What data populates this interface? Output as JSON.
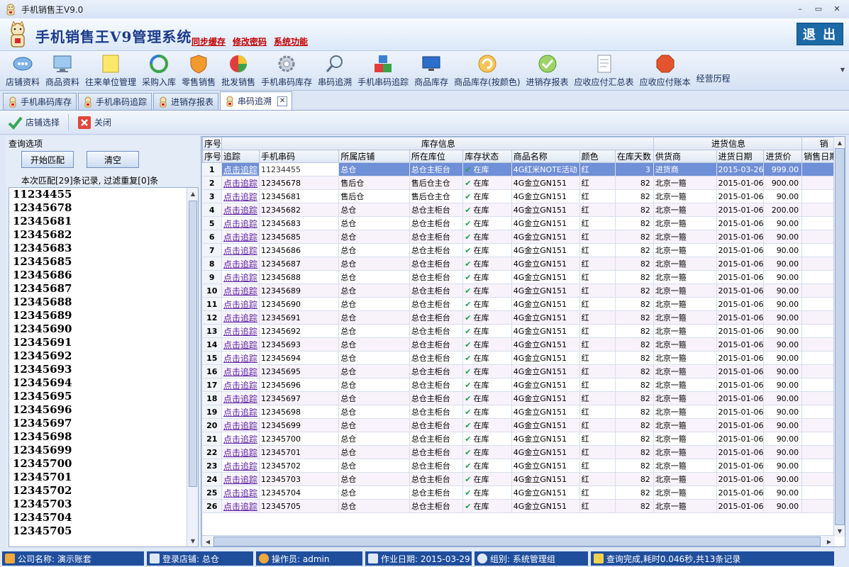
{
  "window": {
    "title": "手机销售王V9.0",
    "min": "–",
    "max": "▭",
    "close": "✕"
  },
  "banner": {
    "system_title": "手机销售王V9管理系统",
    "links": [
      "同步缓存",
      "修改密码",
      "系统功能"
    ],
    "exit_label": "退 出"
  },
  "toolbar": {
    "items": [
      {
        "label": "店铺资料",
        "icon": "store-icon"
      },
      {
        "label": "商品资料",
        "icon": "monitor-icon"
      },
      {
        "label": "往来单位管理",
        "icon": "folder-icon"
      },
      {
        "label": "采购入库",
        "icon": "refresh-icon"
      },
      {
        "label": "零售销售",
        "icon": "shield-icon"
      },
      {
        "label": "批发销售",
        "icon": "cube-icon"
      },
      {
        "label": "手机串码库存",
        "icon": "gear-icon"
      },
      {
        "label": "串码追溯",
        "icon": "magnifier-icon"
      },
      {
        "label": "手机串码追踪",
        "icon": "blocks-icon"
      },
      {
        "label": "商品库存",
        "icon": "monitor-icon"
      },
      {
        "label": "商品库存(按颜色)",
        "icon": "cycle-icon"
      },
      {
        "label": "进销存报表",
        "icon": "check-icon"
      },
      {
        "label": "应收应付汇总表",
        "icon": "document-icon"
      },
      {
        "label": "应收应付账本",
        "icon": "stop-icon"
      },
      {
        "label": "经营历程",
        "icon": ""
      }
    ]
  },
  "tabs": [
    {
      "label": "手机串码库存",
      "active": false
    },
    {
      "label": "手机串码追踪",
      "active": false
    },
    {
      "label": "进销存报表",
      "active": false
    },
    {
      "label": "串码追溯",
      "active": true
    }
  ],
  "subbar": {
    "store_select": "店铺选择",
    "close": "关闭"
  },
  "left": {
    "title": "查询选项",
    "match_button": "开始匹配",
    "clear_button": "清空",
    "match_info": "本次匹配[29]条记录, 过滤重复[0]条",
    "serials": [
      "11234455",
      "12345678",
      "12345681",
      "12345682",
      "12345683",
      "12345685",
      "12345686",
      "12345687",
      "12345688",
      "12345689",
      "12345690",
      "12345691",
      "12345692",
      "12345693",
      "12345694",
      "12345695",
      "12345696",
      "12345697",
      "12345698",
      "12345699",
      "12345700",
      "12345701",
      "12345702",
      "12345703",
      "12345704",
      "12345705"
    ]
  },
  "grid": {
    "group_headers": {
      "seq": "序号",
      "stock": "库存信息",
      "purchase": "进货信息",
      "sale": "销"
    },
    "columns": [
      "序号",
      "追踪",
      "手机串码",
      "所属店铺",
      "所在库位",
      "库存状态",
      "商品名称",
      "颜色",
      "在库天数",
      "供货商",
      "进货日期",
      "进货价",
      "销售日期"
    ],
    "rows": [
      [
        "1",
        "点击追踪",
        "11234455",
        "总仓",
        "总仓主柜台",
        "在库",
        "4G红米NOTE活动",
        "红",
        "3",
        "进货商",
        "2015-03-26",
        "999.00",
        ""
      ],
      [
        "2",
        "点击追踪",
        "12345678",
        "售后仓",
        "售后仓主仓",
        "在库",
        "4G金立GN151",
        "红",
        "82",
        "北京一箍",
        "2015-01-06",
        "900.00",
        ""
      ],
      [
        "3",
        "点击追踪",
        "12345681",
        "售后仓",
        "售后仓主仓",
        "在库",
        "4G金立GN151",
        "红",
        "82",
        "北京一箍",
        "2015-01-06",
        "90.00",
        ""
      ],
      [
        "4",
        "点击追踪",
        "12345682",
        "总仓",
        "总仓主柜台",
        "在库",
        "4G金立GN151",
        "红",
        "82",
        "北京一箍",
        "2015-01-06",
        "200.00",
        ""
      ],
      [
        "5",
        "点击追踪",
        "12345683",
        "总仓",
        "总仓主柜台",
        "在库",
        "4G金立GN151",
        "红",
        "82",
        "北京一箍",
        "2015-01-06",
        "90.00",
        ""
      ],
      [
        "6",
        "点击追踪",
        "12345685",
        "总仓",
        "总仓主柜台",
        "在库",
        "4G金立GN151",
        "红",
        "82",
        "北京一箍",
        "2015-01-06",
        "90.00",
        ""
      ],
      [
        "7",
        "点击追踪",
        "12345686",
        "总仓",
        "总仓主柜台",
        "在库",
        "4G金立GN151",
        "红",
        "82",
        "北京一箍",
        "2015-01-06",
        "90.00",
        ""
      ],
      [
        "8",
        "点击追踪",
        "12345687",
        "总仓",
        "总仓主柜台",
        "在库",
        "4G金立GN151",
        "红",
        "82",
        "北京一箍",
        "2015-01-06",
        "90.00",
        ""
      ],
      [
        "9",
        "点击追踪",
        "12345688",
        "总仓",
        "总仓主柜台",
        "在库",
        "4G金立GN151",
        "红",
        "82",
        "北京一箍",
        "2015-01-06",
        "90.00",
        ""
      ],
      [
        "10",
        "点击追踪",
        "12345689",
        "总仓",
        "总仓主柜台",
        "在库",
        "4G金立GN151",
        "红",
        "82",
        "北京一箍",
        "2015-01-06",
        "90.00",
        ""
      ],
      [
        "11",
        "点击追踪",
        "12345690",
        "总仓",
        "总仓主柜台",
        "在库",
        "4G金立GN151",
        "红",
        "82",
        "北京一箍",
        "2015-01-06",
        "90.00",
        ""
      ],
      [
        "12",
        "点击追踪",
        "12345691",
        "总仓",
        "总仓主柜台",
        "在库",
        "4G金立GN151",
        "红",
        "82",
        "北京一箍",
        "2015-01-06",
        "90.00",
        ""
      ],
      [
        "13",
        "点击追踪",
        "12345692",
        "总仓",
        "总仓主柜台",
        "在库",
        "4G金立GN151",
        "红",
        "82",
        "北京一箍",
        "2015-01-06",
        "90.00",
        ""
      ],
      [
        "14",
        "点击追踪",
        "12345693",
        "总仓",
        "总仓主柜台",
        "在库",
        "4G金立GN151",
        "红",
        "82",
        "北京一箍",
        "2015-01-06",
        "90.00",
        ""
      ],
      [
        "15",
        "点击追踪",
        "12345694",
        "总仓",
        "总仓主柜台",
        "在库",
        "4G金立GN151",
        "红",
        "82",
        "北京一箍",
        "2015-01-06",
        "90.00",
        ""
      ],
      [
        "16",
        "点击追踪",
        "12345695",
        "总仓",
        "总仓主柜台",
        "在库",
        "4G金立GN151",
        "红",
        "82",
        "北京一箍",
        "2015-01-06",
        "90.00",
        ""
      ],
      [
        "17",
        "点击追踪",
        "12345696",
        "总仓",
        "总仓主柜台",
        "在库",
        "4G金立GN151",
        "红",
        "82",
        "北京一箍",
        "2015-01-06",
        "90.00",
        ""
      ],
      [
        "18",
        "点击追踪",
        "12345697",
        "总仓",
        "总仓主柜台",
        "在库",
        "4G金立GN151",
        "红",
        "82",
        "北京一箍",
        "2015-01-06",
        "90.00",
        ""
      ],
      [
        "19",
        "点击追踪",
        "12345698",
        "总仓",
        "总仓主柜台",
        "在库",
        "4G金立GN151",
        "红",
        "82",
        "北京一箍",
        "2015-01-06",
        "90.00",
        ""
      ],
      [
        "20",
        "点击追踪",
        "12345699",
        "总仓",
        "总仓主柜台",
        "在库",
        "4G金立GN151",
        "红",
        "82",
        "北京一箍",
        "2015-01-06",
        "90.00",
        ""
      ],
      [
        "21",
        "点击追踪",
        "12345700",
        "总仓",
        "总仓主柜台",
        "在库",
        "4G金立GN151",
        "红",
        "82",
        "北京一箍",
        "2015-01-06",
        "90.00",
        ""
      ],
      [
        "22",
        "点击追踪",
        "12345701",
        "总仓",
        "总仓主柜台",
        "在库",
        "4G金立GN151",
        "红",
        "82",
        "北京一箍",
        "2015-01-06",
        "90.00",
        ""
      ],
      [
        "23",
        "点击追踪",
        "12345702",
        "总仓",
        "总仓主柜台",
        "在库",
        "4G金立GN151",
        "红",
        "82",
        "北京一箍",
        "2015-01-06",
        "90.00",
        ""
      ],
      [
        "24",
        "点击追踪",
        "12345703",
        "总仓",
        "总仓主柜台",
        "在库",
        "4G金立GN151",
        "红",
        "82",
        "北京一箍",
        "2015-01-06",
        "90.00",
        ""
      ],
      [
        "25",
        "点击追踪",
        "12345704",
        "总仓",
        "总仓主柜台",
        "在库",
        "4G金立GN151",
        "红",
        "82",
        "北京一箍",
        "2015-01-06",
        "90.00",
        ""
      ],
      [
        "26",
        "点击追踪",
        "12345705",
        "总仓",
        "总仓主柜台",
        "在库",
        "4G金立GN151",
        "红",
        "82",
        "北京一箍",
        "2015-01-06",
        "90.00",
        ""
      ]
    ]
  },
  "status": {
    "company": "公司名称: 演示账套",
    "store": "登录店铺: 总仓",
    "operator": "操作员: admin",
    "workdate": "作业日期: 2015-03-29",
    "group": "组别: 系统管理组",
    "result": "查询完成,耗时0.046秒,共13条记录"
  },
  "colors": {
    "accent": "#1f4e9c",
    "selected_row": "#6f8fd6",
    "check": "#1ea24a",
    "link": "#5a1aa0"
  }
}
